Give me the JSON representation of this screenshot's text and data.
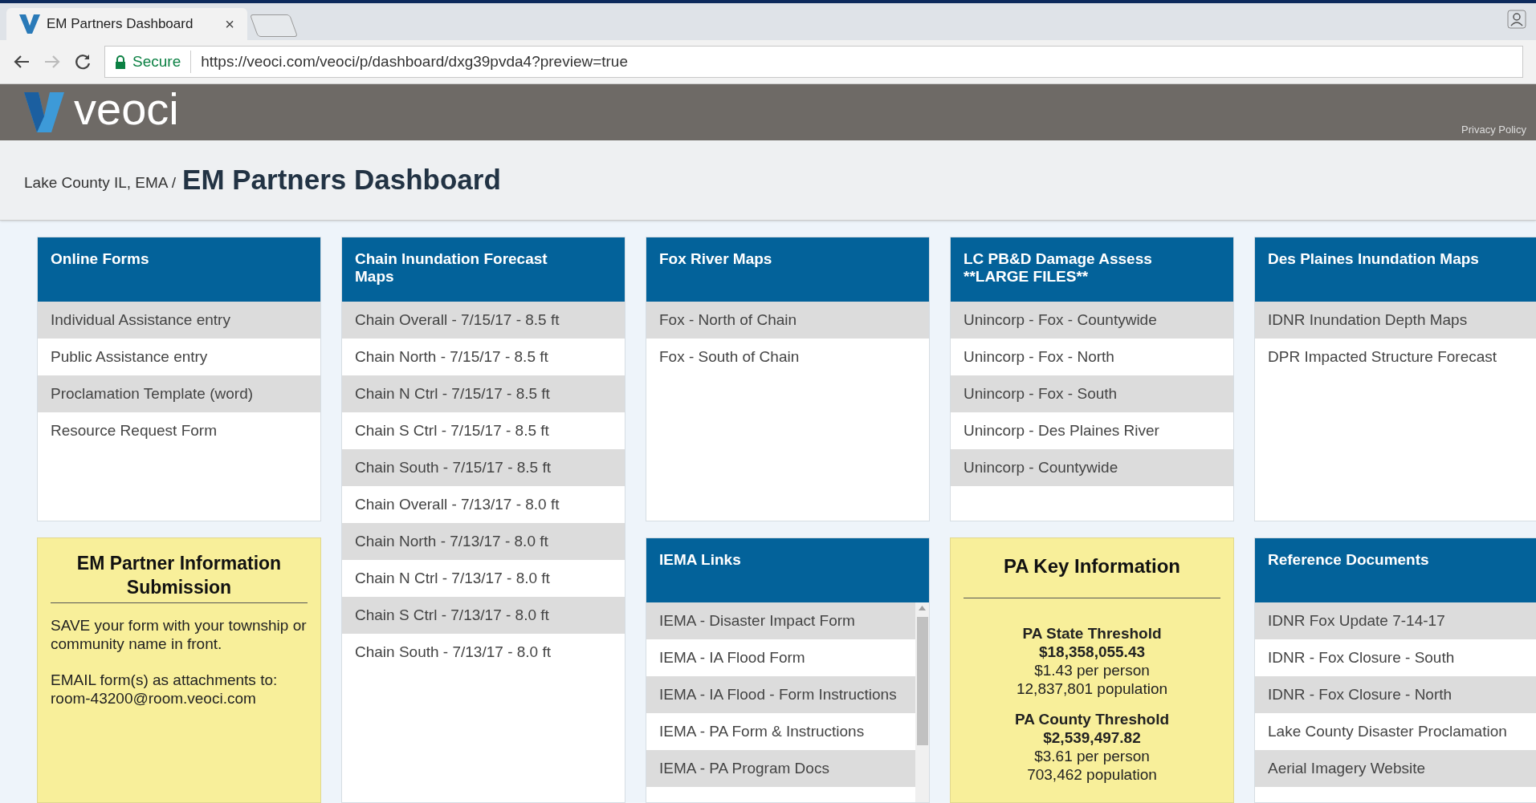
{
  "browser": {
    "tab_title": "EM Partners Dashboard",
    "tab_close": "×",
    "secure_label": "Secure",
    "url": "https://veoci.com/veoci/p/dashboard/dxg39pvda4?preview=true"
  },
  "header": {
    "logo_text": "veoci",
    "privacy_link": "Privacy Policy"
  },
  "breadcrumb": {
    "parent": "Lake County IL, EMA /",
    "title": "EM Partners Dashboard"
  },
  "columns": [
    [
      {
        "kind": "links",
        "title": "Online Forms",
        "items": [
          "Individual Assistance entry",
          "Public Assistance entry",
          "Proclamation Template (word)",
          "Resource Request Form"
        ]
      },
      {
        "kind": "info",
        "title": "EM Partner Information Submission",
        "paragraphs": [
          "SAVE your form with your township or community name in front.",
          "EMAIL form(s) as attachments to: room-43200@room.veoci.com"
        ]
      }
    ],
    [
      {
        "kind": "links",
        "title": "Chain Inundation Forecast Maps",
        "items": [
          "Chain Overall - 7/15/17 - 8.5 ft",
          "Chain North - 7/15/17 - 8.5 ft",
          "Chain N Ctrl - 7/15/17 - 8.5 ft",
          "Chain S Ctrl - 7/15/17 - 8.5 ft",
          "Chain South - 7/15/17 - 8.5 ft",
          "Chain Overall - 7/13/17 - 8.0 ft",
          "Chain North - 7/13/17 - 8.0 ft",
          "Chain N Ctrl - 7/13/17 - 8.0 ft",
          "Chain S Ctrl - 7/13/17 - 8.0 ft",
          "Chain South - 7/13/17 - 8.0 ft"
        ]
      }
    ],
    [
      {
        "kind": "links",
        "title": "Fox River Maps",
        "items": [
          "Fox - North of Chain",
          "Fox - South of Chain"
        ]
      },
      {
        "kind": "scroll_links",
        "title": "IEMA Links",
        "items": [
          "IEMA - Disaster Impact Form",
          "IEMA - IA Flood Form",
          "IEMA - IA Flood - Form Instructions",
          "IEMA - PA Form & Instructions",
          "IEMA - PA Program Docs"
        ]
      }
    ],
    [
      {
        "kind": "links",
        "title": "LC PB&D Damage Assess **LARGE FILES**",
        "items": [
          "Unincorp - Fox - Countywide",
          "Unincorp - Fox - North",
          "Unincorp - Fox - South",
          "Unincorp - Des Plaines River",
          "Unincorp - Countywide"
        ]
      },
      {
        "kind": "key_info",
        "title": "PA Key Information",
        "blocks": [
          {
            "label": "PA State Threshold",
            "amount": "$18,358,055.43",
            "per_person": "$1.43 per person",
            "population": "12,837,801 population"
          },
          {
            "label": "PA County Threshold",
            "amount": "$2,539,497.82",
            "per_person": "$3.61 per person",
            "population": "703,462 population"
          }
        ]
      }
    ],
    [
      {
        "kind": "links",
        "title": "Des Plaines Inundation Maps",
        "items": [
          "IDNR Inundation Depth Maps",
          "DPR Impacted Structure Forecast"
        ]
      },
      {
        "kind": "links",
        "title": "Reference Documents",
        "items": [
          "IDNR Fox Update 7-14-17",
          "IDNR - Fox Closure - South",
          "IDNR - Fox Closure - North",
          "Lake County Disaster Proclamation",
          "Aerial Imagery Website"
        ]
      }
    ]
  ]
}
